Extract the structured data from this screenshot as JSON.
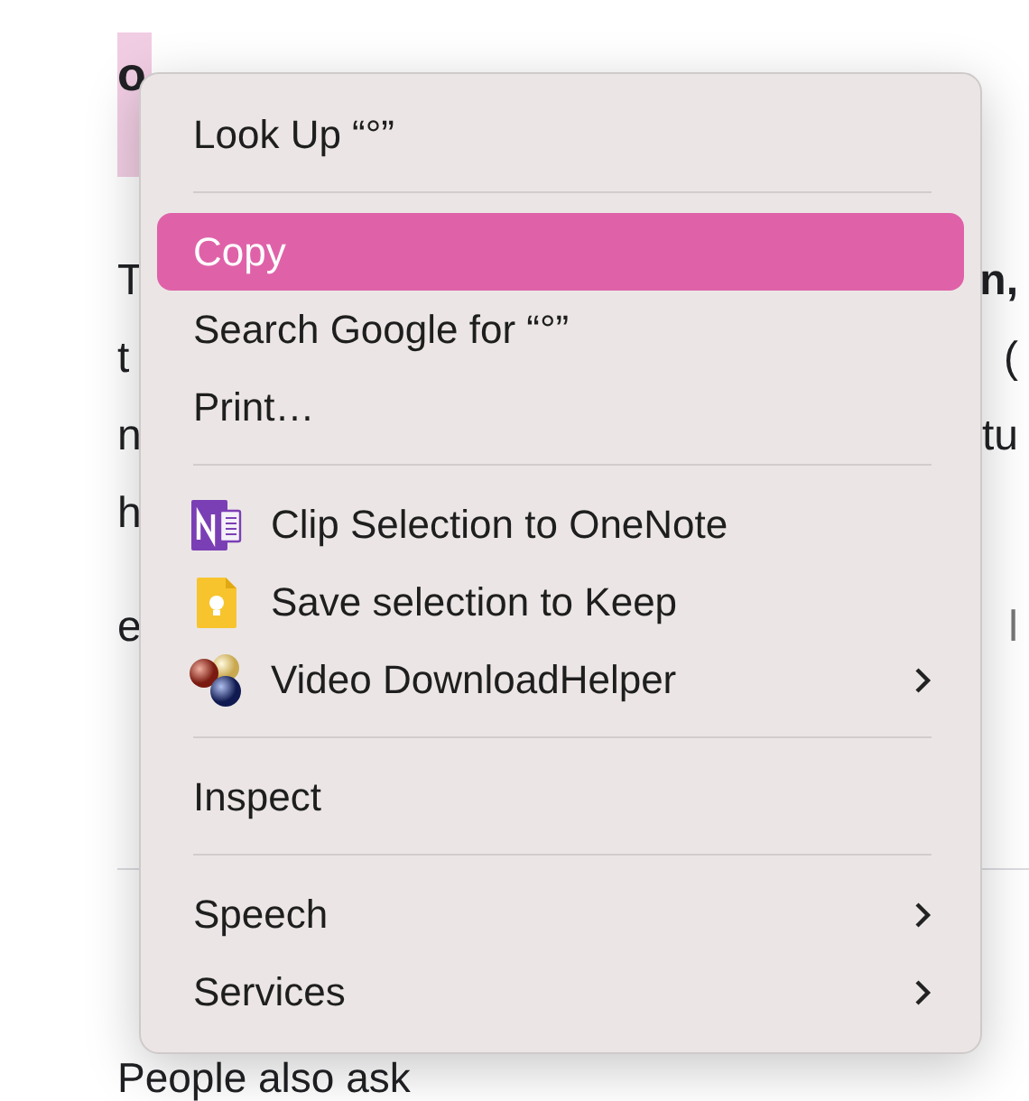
{
  "page": {
    "selected_text": "o",
    "lines": [
      {
        "left": "T",
        "right": "n,",
        "right_bold": true
      },
      {
        "left": "t",
        "right": "(",
        "right_bold": false
      },
      {
        "left": "n",
        "right": "tu",
        "right_bold": false
      },
      {
        "left": "h"
      }
    ],
    "line_after": {
      "left": "e",
      "right": "l"
    },
    "heading": "People also ask"
  },
  "context_menu": {
    "items": [
      {
        "kind": "item",
        "label": "Look Up “°”",
        "selected": false
      },
      {
        "kind": "separator"
      },
      {
        "kind": "item",
        "label": "Copy",
        "selected": true
      },
      {
        "kind": "item",
        "label": "Search Google for “°”",
        "selected": false
      },
      {
        "kind": "item",
        "label": "Print…",
        "selected": false
      },
      {
        "kind": "separator"
      },
      {
        "kind": "notebook",
        "label": "Clip Selection to OneNote",
        "selected": false
      },
      {
        "kind": "note",
        "label": "Save selection to Keep",
        "selected": false
      },
      {
        "kind": "spheres",
        "label": "Video DownloadHelper",
        "selected": false,
        "submenu": true
      },
      {
        "kind": "separator"
      },
      {
        "kind": "item",
        "label": "Inspect",
        "selected": false
      },
      {
        "kind": "separator"
      },
      {
        "kind": "item",
        "label": "Speech",
        "selected": false,
        "submenu": true
      },
      {
        "kind": "item",
        "label": "Services",
        "selected": false,
        "submenu": true
      }
    ]
  }
}
